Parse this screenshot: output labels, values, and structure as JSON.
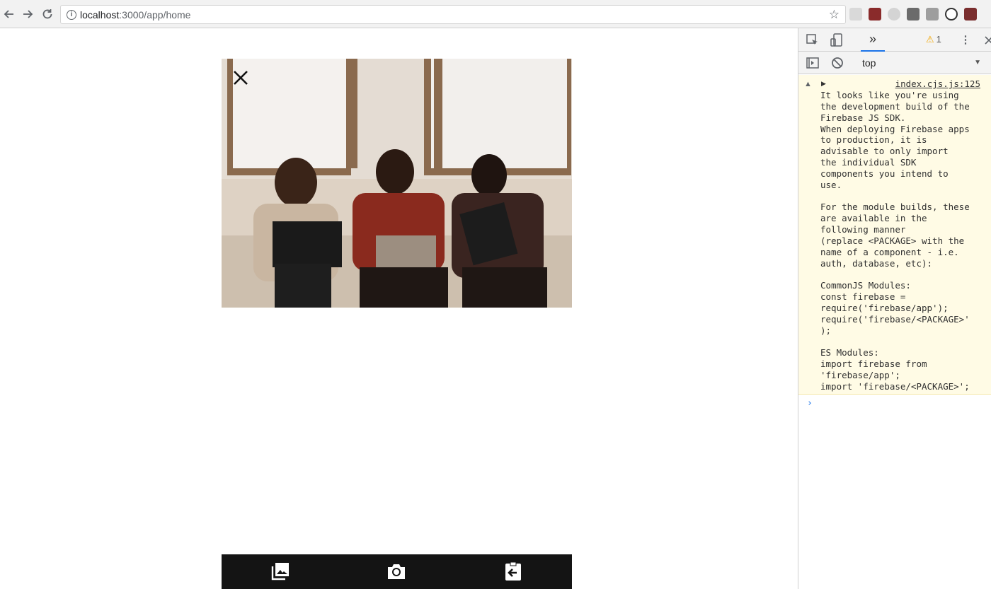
{
  "browser": {
    "url_host": "localhost",
    "url_path": ":3000/app/home"
  },
  "app": {
    "photo_description_icon": "image",
    "bottom_bar": {
      "gallery_icon": "photo-library-icon",
      "camera_icon": "camera-icon",
      "exit_icon": "back-arrow-icon"
    }
  },
  "devtools": {
    "warning_count": "1",
    "context": "top",
    "message": {
      "source": "index.cjs.js:125",
      "lines": [
        "It looks like you're using",
        "the development build of the",
        "Firebase JS SDK.",
        "When deploying Firebase apps",
        "to production, it is",
        "advisable to only import",
        "the individual SDK",
        "components you intend to",
        "use.",
        "",
        "For the module builds, these",
        "are available in the",
        "following manner",
        "(replace <PACKAGE> with the",
        "name of a component - i.e.",
        "auth, database, etc):",
        "",
        "CommonJS Modules:",
        "const firebase =",
        "require('firebase/app');",
        "require('firebase/<PACKAGE>'",
        ");",
        "",
        "ES Modules:",
        "import firebase from",
        "'firebase/app';",
        "import 'firebase/<PACKAGE>';"
      ]
    }
  }
}
